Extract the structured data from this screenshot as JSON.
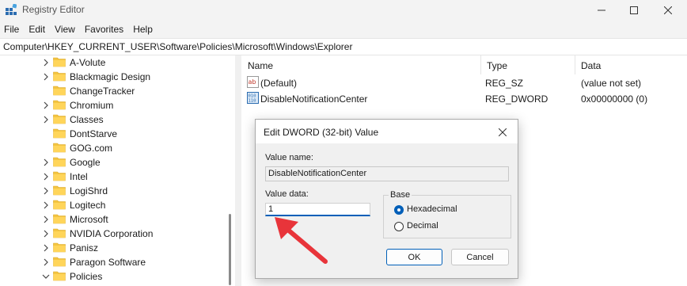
{
  "window": {
    "title": "Registry Editor"
  },
  "menu": {
    "items": [
      "File",
      "Edit",
      "View",
      "Favorites",
      "Help"
    ]
  },
  "address": {
    "path": "Computer\\HKEY_CURRENT_USER\\Software\\Policies\\Microsoft\\Windows\\Explorer"
  },
  "tree": {
    "items": [
      {
        "label": "A-Volute",
        "expander": "collapsed"
      },
      {
        "label": "Blackmagic Design",
        "expander": "collapsed"
      },
      {
        "label": "ChangeTracker",
        "expander": "none"
      },
      {
        "label": "Chromium",
        "expander": "collapsed"
      },
      {
        "label": "Classes",
        "expander": "collapsed"
      },
      {
        "label": "DontStarve",
        "expander": "none"
      },
      {
        "label": "GOG.com",
        "expander": "none"
      },
      {
        "label": "Google",
        "expander": "collapsed"
      },
      {
        "label": "Intel",
        "expander": "collapsed"
      },
      {
        "label": "LogiShrd",
        "expander": "collapsed"
      },
      {
        "label": "Logitech",
        "expander": "collapsed"
      },
      {
        "label": "Microsoft",
        "expander": "collapsed"
      },
      {
        "label": "NVIDIA Corporation",
        "expander": "collapsed"
      },
      {
        "label": "Panisz",
        "expander": "collapsed"
      },
      {
        "label": "Paragon Software",
        "expander": "collapsed"
      },
      {
        "label": "Policies",
        "expander": "expanded"
      }
    ]
  },
  "list": {
    "columns": [
      "Name",
      "Type",
      "Data"
    ],
    "rows": [
      {
        "name": "(Default)",
        "type": "REG_SZ",
        "data": "(value not set)",
        "icon": "string-value-icon"
      },
      {
        "name": "DisableNotificationCenter",
        "type": "REG_DWORD",
        "data": "0x00000000 (0)",
        "icon": "dword-value-icon"
      }
    ]
  },
  "dialog": {
    "title": "Edit DWORD (32-bit) Value",
    "value_name_label": "Value name:",
    "value_name": "DisableNotificationCenter",
    "value_data_label": "Value data:",
    "value_data": "1",
    "base_label": "Base",
    "base_options": [
      {
        "label": "Hexadecimal",
        "selected": true
      },
      {
        "label": "Decimal",
        "selected": false
      }
    ],
    "ok_label": "OK",
    "cancel_label": "Cancel"
  },
  "colors": {
    "accent": "#005fb8",
    "folder": "#f4c542",
    "arrow": "#e8343a"
  }
}
